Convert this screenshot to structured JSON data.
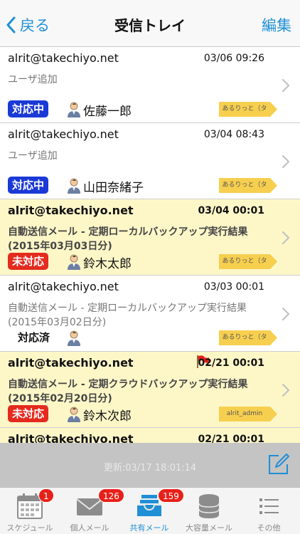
{
  "nav": {
    "back_label": "戻る",
    "title": "受信トレイ",
    "edit_label": "編集"
  },
  "messages": [
    {
      "sender": "alrit@takechiyo.net",
      "date": "03/06 09:26",
      "subject": "ユーザ追加",
      "status": "対応中",
      "assignee": "佐藤一郎",
      "tag": "あるりっと（タ",
      "unread": false
    },
    {
      "sender": "alrit@takechiyo.net",
      "date": "03/04 08:43",
      "subject": "ユーザ追加",
      "status": "対応中",
      "assignee": "山田奈緒子",
      "tag": "あるりっと（タ",
      "unread": false
    },
    {
      "sender": "alrit@takechiyo.net",
      "date": "03/04 00:01",
      "subject": "自動送信メール - 定期ローカルバックアップ実行結果(2015年03月03日分)",
      "status": "未対応",
      "assignee": "鈴木太郎",
      "tag": "あるりっと（タ",
      "unread": true
    },
    {
      "sender": "alrit@takechiyo.net",
      "date": "03/03 00:01",
      "subject": "自動送信メール - 定期ローカルバックアップ実行結果(2015年03月02日分)",
      "status": "対応済",
      "assignee": "",
      "tag": "あるりっと（タ",
      "unread": false
    },
    {
      "sender": "alrit@takechiyo.net",
      "date": "02/21 00:01",
      "subject": "自動送信メール - 定期クラウドバックアップ実行結果(2015年02月20日分)",
      "status": "未対応",
      "assignee": "鈴木次郎",
      "tag": "alrit_admin",
      "unread": true,
      "flagged": true
    },
    {
      "sender": "alrit@takechiyo.net",
      "date": "02/21 00:01",
      "subject": "",
      "status": "",
      "assignee": "",
      "tag": "",
      "unread": true
    }
  ],
  "footer": {
    "update_text": "更新:03/17 18:01:14"
  },
  "tabs": [
    {
      "label": "スケジュール",
      "badge": "1",
      "icon": "calendar-icon"
    },
    {
      "label": "個人メール",
      "badge": "126",
      "icon": "envelope-icon"
    },
    {
      "label": "共有メール",
      "badge": "159",
      "icon": "inbox-tray-icon",
      "active": true
    },
    {
      "label": "大容量メール",
      "badge": "",
      "icon": "database-icon"
    },
    {
      "label": "その他",
      "badge": "",
      "icon": "list-icon"
    }
  ],
  "colors": {
    "accent": "#1f8fd6",
    "unread_bg": "#fdf7c8",
    "status_in_progress": "#1a39d6",
    "status_unhandled": "#e52a1e",
    "tag": "#f7cf4f",
    "badge": "#e8201a"
  }
}
